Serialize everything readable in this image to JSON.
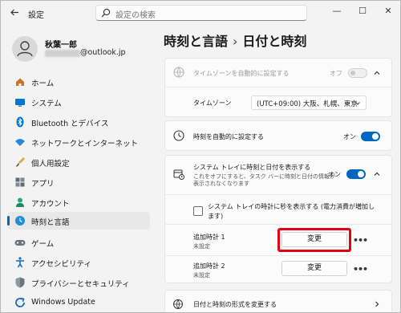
{
  "app": {
    "title": "設定"
  },
  "search": {
    "placeholder": "設定の検索"
  },
  "window_controls": {
    "minimize": "—",
    "maximize": "☐",
    "close": "✕"
  },
  "account": {
    "name": "秋葉一郎",
    "email_suffix": "@outlook.jp"
  },
  "sidebar": {
    "items": [
      {
        "label": "ホーム",
        "icon": "home-icon"
      },
      {
        "label": "システム",
        "icon": "monitor-icon"
      },
      {
        "label": "Bluetooth とデバイス",
        "icon": "bluetooth-icon"
      },
      {
        "label": "ネットワークとインターネット",
        "icon": "wifi-icon"
      },
      {
        "label": "個人用設定",
        "icon": "brush-icon"
      },
      {
        "label": "アプリ",
        "icon": "apps-icon"
      },
      {
        "label": "アカウント",
        "icon": "person-icon"
      },
      {
        "label": "時刻と言語",
        "icon": "globe-clock-icon",
        "active": true
      },
      {
        "label": "ゲーム",
        "icon": "gamepad-icon"
      },
      {
        "label": "アクセシビリティ",
        "icon": "accessibility-icon"
      },
      {
        "label": "プライバシーとセキュリティ",
        "icon": "shield-icon"
      },
      {
        "label": "Windows Update",
        "icon": "update-icon"
      }
    ]
  },
  "breadcrumb": {
    "parent": "時刻と言語",
    "separator": "›",
    "current": "日付と時刻"
  },
  "settings": {
    "auto_timezone": {
      "label": "タイムゾーンを自動的に設定する",
      "state": "オフ",
      "enabled": false
    },
    "timezone": {
      "label": "タイムゾーン",
      "value": "(UTC+09:00) 大阪、札幌、東京"
    },
    "auto_time": {
      "label": "時刻を自動的に設定する",
      "state": "オン",
      "on": true
    },
    "tray": {
      "label": "システム トレイに時刻と日付を表示する",
      "description_line1": "これをオフにすると、タスク バーに時刻と日付の情報が",
      "description_line2": "表示されなくなります",
      "state": "オン",
      "on": true
    },
    "show_seconds": {
      "label_line1": "システム トレイの時計に秒を表示する (電力消費が増加し",
      "label_line2": "ます)",
      "checked": false
    },
    "clock1": {
      "label": "追加時計 1",
      "status": "未設定",
      "button": "変更",
      "more": "•••"
    },
    "clock2": {
      "label": "追加時計 2",
      "status": "未設定",
      "button": "変更",
      "more": "•••"
    },
    "format": {
      "label": "日付と時刻の形式を変更する"
    }
  },
  "colors": {
    "accent": "#0067c0",
    "highlight": "#e60012"
  }
}
